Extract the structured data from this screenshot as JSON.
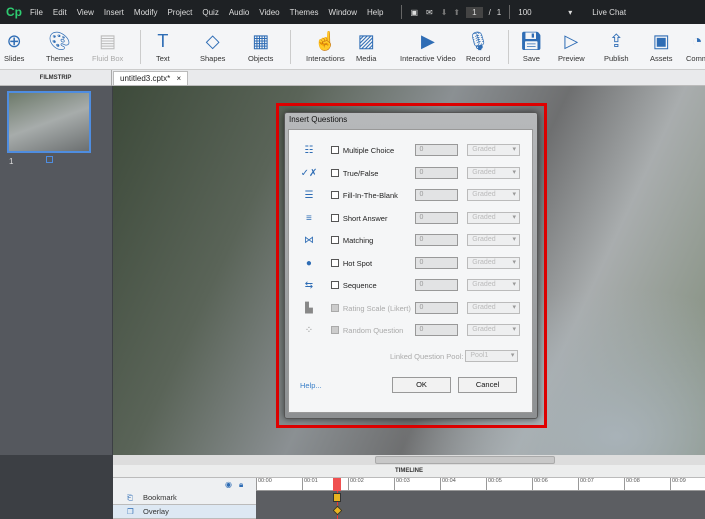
{
  "menubar": {
    "logo": "Cp",
    "items": [
      "File",
      "Edit",
      "View",
      "Insert",
      "Modify",
      "Project",
      "Quiz",
      "Audio",
      "Video",
      "Themes",
      "Window",
      "Help"
    ],
    "page_current": "1",
    "page_sep": "/",
    "page_total": "1",
    "zoom": "100",
    "live_chat": "Live Chat"
  },
  "toolbar": [
    {
      "label": "Slides",
      "icon": "plus-circle"
    },
    {
      "label": "Themes",
      "icon": "palette"
    },
    {
      "label": "Fluid Box",
      "icon": "fluid-box"
    },
    {
      "label": "Text",
      "icon": "text-T"
    },
    {
      "label": "Shapes",
      "icon": "shapes"
    },
    {
      "label": "Objects",
      "icon": "objects"
    },
    {
      "label": "Interactions",
      "icon": "hand"
    },
    {
      "label": "Media",
      "icon": "image"
    },
    {
      "label": "Interactive Video",
      "icon": "video"
    },
    {
      "label": "Record",
      "icon": "microphone"
    },
    {
      "label": "Save",
      "icon": "floppy"
    },
    {
      "label": "Preview",
      "icon": "play"
    },
    {
      "label": "Publish",
      "icon": "publish"
    },
    {
      "label": "Assets",
      "icon": "box"
    },
    {
      "label": "Comm",
      "icon": "comments"
    }
  ],
  "filmstrip": {
    "title": "FILMSTRIP",
    "slide_number": "1"
  },
  "doc_tab": {
    "label": "untitled3.cptx*",
    "close": "×"
  },
  "dialog": {
    "title": "Insert Questions",
    "questions": [
      {
        "label": "Multiple Choice",
        "count": "0",
        "type": "Graded",
        "icon": "☷",
        "enabled": true
      },
      {
        "label": "True/False",
        "count": "0",
        "type": "Graded",
        "icon": "✓✗",
        "enabled": true
      },
      {
        "label": "Fill-In-The-Blank",
        "count": "0",
        "type": "Graded",
        "icon": "☰",
        "enabled": true
      },
      {
        "label": "Short Answer",
        "count": "0",
        "type": "Graded",
        "icon": "≡",
        "enabled": true
      },
      {
        "label": "Matching",
        "count": "0",
        "type": "Graded",
        "icon": "⋈",
        "enabled": true
      },
      {
        "label": "Hot Spot",
        "count": "0",
        "type": "Graded",
        "icon": "●",
        "enabled": true
      },
      {
        "label": "Sequence",
        "count": "0",
        "type": "Graded",
        "icon": "⇆",
        "enabled": true
      },
      {
        "label": "Rating Scale (Likert)",
        "count": "0",
        "type": "Graded",
        "icon": "▙",
        "enabled": false
      },
      {
        "label": "Random Question",
        "count": "0",
        "type": "Graded",
        "icon": "⁘",
        "enabled": false
      }
    ],
    "pool_label": "Linked Question Pool:",
    "pool_value": "Pool1",
    "help": "Help...",
    "ok": "OK",
    "cancel": "Cancel"
  },
  "timeline": {
    "title": "TIMELINE",
    "ticks": [
      "00:00",
      "00:01",
      "00:02",
      "00:03",
      "00:04",
      "00:05",
      "00:06",
      "00:07",
      "00:08",
      "00:09"
    ],
    "rows": [
      "Bookmark",
      "Overlay"
    ]
  }
}
